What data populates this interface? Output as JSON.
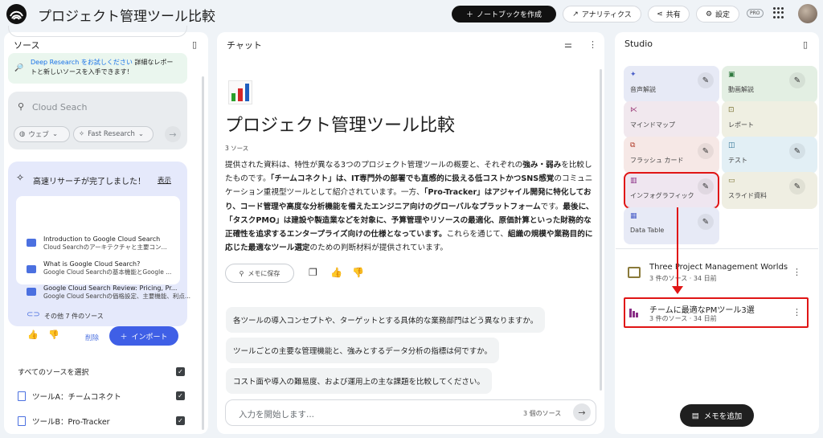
{
  "header": {
    "title": "プロジェクト管理ツール比較",
    "create_label": "ノートブックを作成",
    "analytics_label": "アナリティクス",
    "share_label": "共有",
    "settings_label": "設定",
    "pro_badge": "PRO"
  },
  "sources": {
    "panel_title": "ソース",
    "deep_research": {
      "link": "Deep Research をお試しください",
      "text1": " 詳細なレポー",
      "text2": "トと新しいソースを入手できます！"
    },
    "search": {
      "placeholder": "Cloud Seach",
      "chip_web": "ウェブ",
      "chip_fast": "Fast Research"
    },
    "result": {
      "title": "高速リサーチが完了しました！",
      "show": "表示",
      "items": [
        {
          "title": "Introduction to Google Cloud Search",
          "snippet": "Cloud Searchのアーキテクチャと主要コン..."
        },
        {
          "title": "What is Google Cloud Search?",
          "snippet": "Google Cloud Searchの基本機能とGoogle ..."
        },
        {
          "title": "Google Cloud Search Review: Pricing, Pr...",
          "snippet": "Google Cloud Searchの価格設定、主要機能、利点..."
        }
      ],
      "more": "その他 7 件のソース",
      "delete": "削除",
      "import": "インポート"
    },
    "select_all": "すべてのソースを選択",
    "list": [
      {
        "label": "ツールA：チームコネクト"
      },
      {
        "label": "ツールB：Pro-Tracker"
      }
    ]
  },
  "chat": {
    "panel_title": "チャット",
    "title": "プロジェクト管理ツール比較",
    "source_count": "3 ソース",
    "body": [
      {
        "t": "提供された資料は、特性が異なる3つのプロジェクト管理ツールの概要と、それぞれの",
        "b": false
      },
      {
        "t": "強み・弱み",
        "b": true
      },
      {
        "t": "を比較したものです。",
        "b": false
      },
      {
        "t": "「チームコネクト」は、IT専門外の部署でも直感的に扱える低コストかつSNS感覚",
        "b": true
      },
      {
        "t": "のコミュニケーション重視型ツールとして紹介されています。一方、",
        "b": false
      },
      {
        "t": "「Pro-Tracker」はアジャイル開発に特化しており、コード管理や高度な分析機能を備えたエンジニア向けのグローバルなプラットフォーム",
        "b": true
      },
      {
        "t": "です。",
        "b": false
      },
      {
        "t": "最後に、「タスクPMO」は建設や製造業などを対象に、予算管理やリソースの最適化、原価計算といった財務的な正確性を追求するエンタープライズ向けの仕様となっています。",
        "b": true
      },
      {
        "t": "これらを通じて、",
        "b": false
      },
      {
        "t": "組織の規模や業務目的に応じた最適なツール選定",
        "b": true
      },
      {
        "t": "のための判断材料が提供されています。",
        "b": false
      }
    ],
    "save_memo": "メモに保存",
    "suggestions": [
      "各ツールの導入コンセプトや、ターゲットとする具体的な業務部門はどう異なりますか。",
      "ツールごとの主要な管理機能と、強みとするデータ分析の指標は何ですか。",
      "コスト面や導入の難易度、および運用上の主な課題を比較してください。"
    ],
    "input_placeholder": "入力を開始します...",
    "input_source_count": "3 個のソース"
  },
  "studio": {
    "panel_title": "Studio",
    "tiles": [
      {
        "label": "音声解説",
        "icon": "audio-icon",
        "bg": "#e7eaf6"
      },
      {
        "label": "動画解説",
        "icon": "video-icon",
        "bg": "#e3efe3"
      },
      {
        "label": "マインドマップ",
        "icon": "mindmap-icon",
        "bg": "#f1e8ee"
      },
      {
        "label": "レポート",
        "icon": "report-icon",
        "bg": "#efefe2"
      },
      {
        "label": "フラッシュ カード",
        "icon": "flashcard-icon",
        "bg": "#f6e8e6"
      },
      {
        "label": "テスト",
        "icon": "quiz-icon",
        "bg": "#e2eff5"
      },
      {
        "label": "インフォグラフィック",
        "icon": "infographic-icon",
        "bg": "#efe6f0"
      },
      {
        "label": "スライド資料",
        "icon": "slides-icon",
        "bg": "#efeee2"
      },
      {
        "label": "Data Table",
        "icon": "table-icon",
        "bg": "#e7eaf6"
      }
    ],
    "notes": [
      {
        "title": "Three Project Management Worlds",
        "sub": "3 件のソース · 34 日前"
      },
      {
        "title": "チームに最適なPMツール3選",
        "sub": "3 件のソース · 34 日前"
      }
    ],
    "add_note": "メモを追加"
  }
}
